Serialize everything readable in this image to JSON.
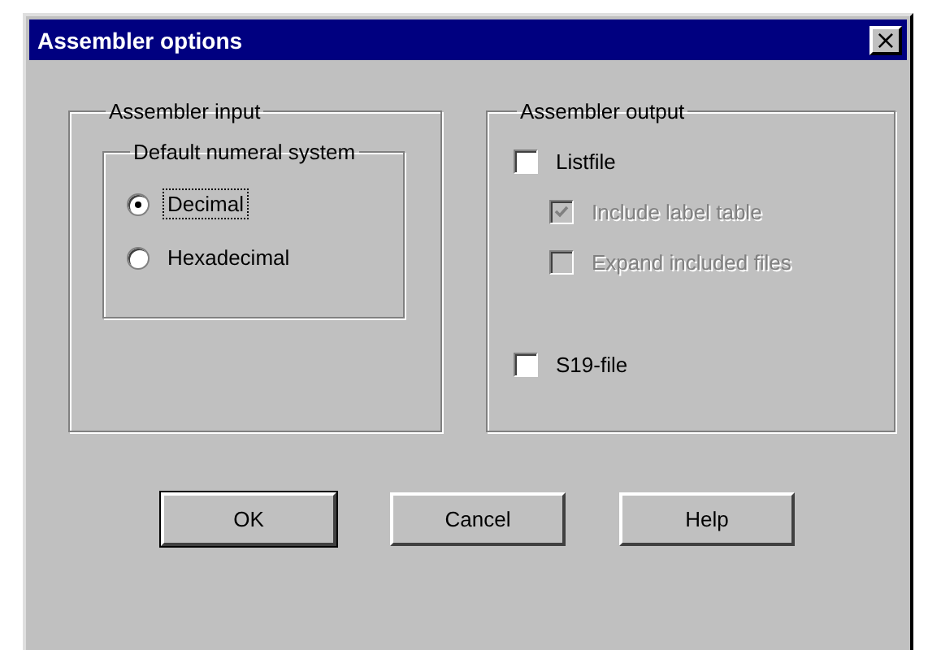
{
  "window": {
    "title": "Assembler options",
    "close": "×"
  },
  "input_group": {
    "title": "Assembler input",
    "numeral_group": {
      "title": "Default numeral system",
      "options": [
        {
          "label": "Decimal",
          "selected": true,
          "focused": true
        },
        {
          "label": "Hexadecimal",
          "selected": false,
          "focused": false
        }
      ]
    }
  },
  "output_group": {
    "title": "Assembler output",
    "options": [
      {
        "label": "Listfile",
        "checked": false,
        "disabled": false,
        "indented": false,
        "gap_before": false
      },
      {
        "label": "Include label table",
        "checked": true,
        "disabled": true,
        "indented": true,
        "gap_before": false
      },
      {
        "label": "Expand included files",
        "checked": false,
        "disabled": true,
        "indented": true,
        "gap_before": false
      },
      {
        "label": "S19-file",
        "checked": false,
        "disabled": false,
        "indented": false,
        "gap_before": true
      }
    ]
  },
  "buttons": [
    {
      "label": "OK",
      "default": true
    },
    {
      "label": "Cancel",
      "default": false
    },
    {
      "label": "Help",
      "default": false
    }
  ]
}
